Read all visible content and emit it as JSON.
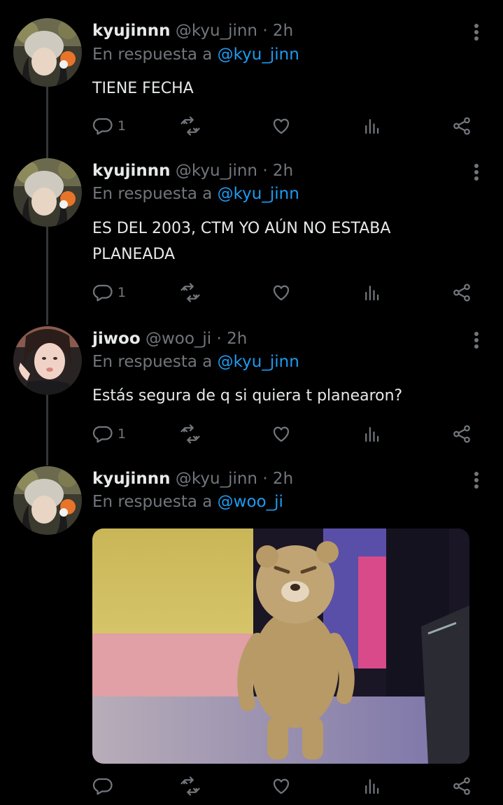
{
  "tweets": [
    {
      "name": "kyujinnn",
      "handle": "@kyu_jinn",
      "time": "· 2h",
      "reply_prefix": "En respuesta a",
      "reply_to": "@kyu_jinn",
      "text": "TIENE FECHA",
      "reply_count": "1"
    },
    {
      "name": "kyujinnn",
      "handle": "@kyu_jinn",
      "time": "· 2h",
      "reply_prefix": "En respuesta a",
      "reply_to": "@kyu_jinn",
      "text": "ES DEL 2003, CTM YO AÚN NO ESTABA PLANEADA",
      "reply_count": "1"
    },
    {
      "name": "jiwoo",
      "handle": "@woo_ji",
      "time": "· 2h",
      "reply_prefix": "En respuesta a",
      "reply_to": "@kyu_jinn",
      "text": "Estás segura de q si quiera t planearon?",
      "reply_count": "1"
    },
    {
      "name": "kyujinnn",
      "handle": "@kyu_jinn",
      "time": "· 2h",
      "reply_prefix": "En respuesta a",
      "reply_to": "@woo_ji",
      "text": "",
      "reply_count": ""
    }
  ],
  "icons": {
    "reply": "reply-icon",
    "retweet": "retweet-icon",
    "like": "heart-icon",
    "views": "analytics-icon",
    "share": "share-icon",
    "more": "more-vertical-icon"
  },
  "colors": {
    "background": "#000000",
    "text": "#e7e9ea",
    "muted": "#71767b",
    "link": "#1d9bf0",
    "thread_line": "#333639"
  }
}
